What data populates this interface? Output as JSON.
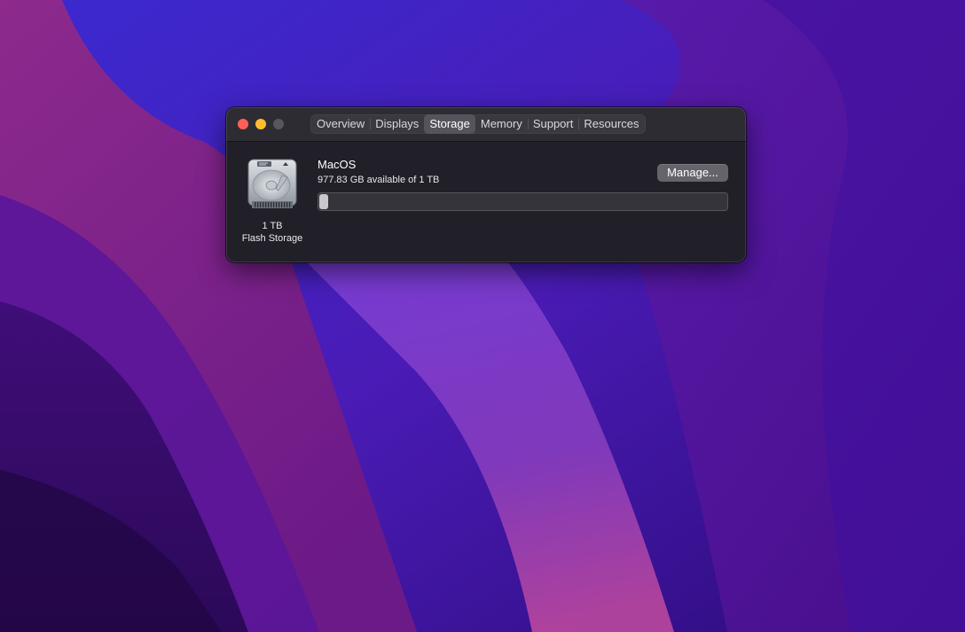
{
  "window": {
    "tabs": [
      {
        "label": "Overview",
        "active": false
      },
      {
        "label": "Displays",
        "active": false
      },
      {
        "label": "Storage",
        "active": true
      },
      {
        "label": "Memory",
        "active": false
      },
      {
        "label": "Support",
        "active": false
      },
      {
        "label": "Resources",
        "active": false
      }
    ]
  },
  "storage": {
    "disk_icon": "hard-drive-icon",
    "capacity_label": "1 TB",
    "type_label": "Flash Storage",
    "volume_name": "MacOS",
    "availability": "977.83 GB available of 1 TB",
    "manage_label": "Manage...",
    "used_fraction": 0.022
  },
  "colors": {
    "close": "#ff5f57",
    "minimize": "#febc2e",
    "zoom_disabled": "#58565d",
    "window_bg": "#211f27",
    "titlebar_bg": "#2e2c33"
  }
}
